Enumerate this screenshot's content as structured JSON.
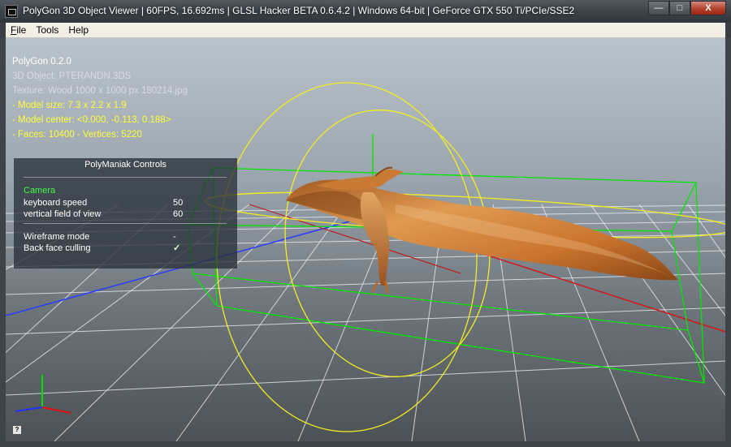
{
  "window": {
    "title": "PolyGon 3D Object Viewer | 60FPS, 16.692ms | GLSL Hacker BETA 0.6.4.2 | Windows 64-bit | GeForce GTX 550 Ti/PCIe/SSE2",
    "buttons": {
      "minimize": "—",
      "maximize": "□",
      "close": "X"
    }
  },
  "menu": {
    "items": [
      {
        "key": "F",
        "rest": "ile"
      },
      {
        "key": "",
        "rest": "Tools"
      },
      {
        "key": "",
        "rest": "Help"
      }
    ]
  },
  "hud": {
    "app_version": "PolyGon 0.2.0",
    "object": "3D Object: PTERANDN.3DS",
    "texture": "Texture: Wood 1000 x 1000 px 180214.jpg",
    "model_size": "- Model size:  7.3 x 2.2 x 1.9",
    "model_center": "- Model center:  <0.000, -0.113, 0.188>",
    "faces_vertices": "- Faces: 10400 - Vertices: 5220"
  },
  "controls": {
    "title": "PolyManiak Controls",
    "section": "Camera",
    "keyboard_speed_label": "keyboard speed",
    "keyboard_speed_value": "50",
    "fov_label": "vertical field of view",
    "fov_value": "60",
    "wireframe_label": "Wireframe mode",
    "wireframe_value": "-",
    "backface_label": "Back face culling",
    "backface_value": "✓"
  },
  "help_button": "?",
  "colors": {
    "hud_yellow": "#ffff3a",
    "section_green": "#44ff44",
    "bbox_green": "#00ff00",
    "orbit_yellow": "#ffff00",
    "model_orange": "#d9853f"
  }
}
